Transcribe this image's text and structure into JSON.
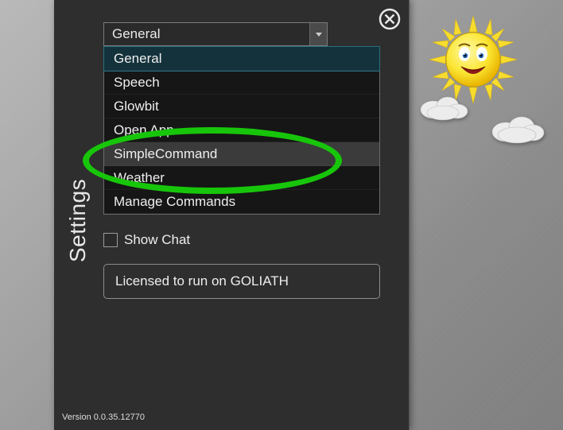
{
  "panel": {
    "title": "Settings",
    "combo_selected": "General",
    "dropdown_items": [
      {
        "label": "General",
        "state": "selected"
      },
      {
        "label": "Speech",
        "state": ""
      },
      {
        "label": "Glowbit",
        "state": ""
      },
      {
        "label": "Open App",
        "state": ""
      },
      {
        "label": "SimpleCommand",
        "state": "hover"
      },
      {
        "label": "Weather",
        "state": ""
      },
      {
        "label": "Manage Commands",
        "state": ""
      }
    ],
    "show_chat_label": "Show Chat",
    "license_text": "Licensed to run on GOLIATH",
    "version_text": "Version 0.0.35.12770"
  },
  "annotation": {
    "color": "#17c60a",
    "highlights": "SimpleCommand"
  }
}
